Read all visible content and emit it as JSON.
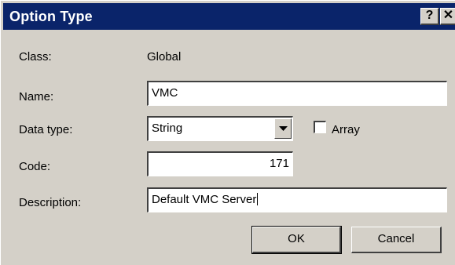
{
  "window": {
    "title": "Option Type",
    "help_glyph": "?",
    "close_glyph": "✕"
  },
  "form": {
    "class_label": "Class:",
    "class_value": "Global",
    "name_label": "Name:",
    "name_value": "VMC",
    "datatype_label": "Data type:",
    "datatype_value": "String",
    "array_label": "Array",
    "array_checked": false,
    "code_label": "Code:",
    "code_value": "171",
    "description_label": "Description:",
    "description_value": "Default VMC Server"
  },
  "buttons": {
    "ok_label": "OK",
    "cancel_label": "Cancel"
  },
  "colors": {
    "titlebar": "#0a246a",
    "dialog_bg": "#d4d0c8"
  }
}
